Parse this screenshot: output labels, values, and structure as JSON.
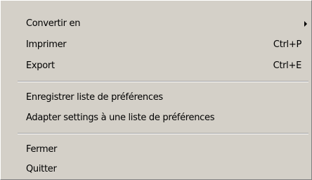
{
  "menu": {
    "items": [
      {
        "label": "Convertir en",
        "shortcut": "",
        "submenu": true
      },
      {
        "label": "Imprimer",
        "shortcut": "Ctrl+P",
        "submenu": false
      },
      {
        "label": "Export",
        "shortcut": "Ctrl+E",
        "submenu": false
      },
      {
        "label": "Enregistrer liste de préférences",
        "shortcut": "",
        "submenu": false
      },
      {
        "label": "Adapter settings à une liste de préférences",
        "shortcut": "",
        "submenu": false
      },
      {
        "label": "Fermer",
        "shortcut": "",
        "submenu": false
      },
      {
        "label": "Quitter",
        "shortcut": "",
        "submenu": false
      }
    ],
    "colors": {
      "background": "#d4d0c8",
      "text": "#000000",
      "separator_dark": "#a0a0a0",
      "separator_light": "#ffffff"
    },
    "icons": {
      "submenu": "submenu-arrow-icon"
    }
  }
}
